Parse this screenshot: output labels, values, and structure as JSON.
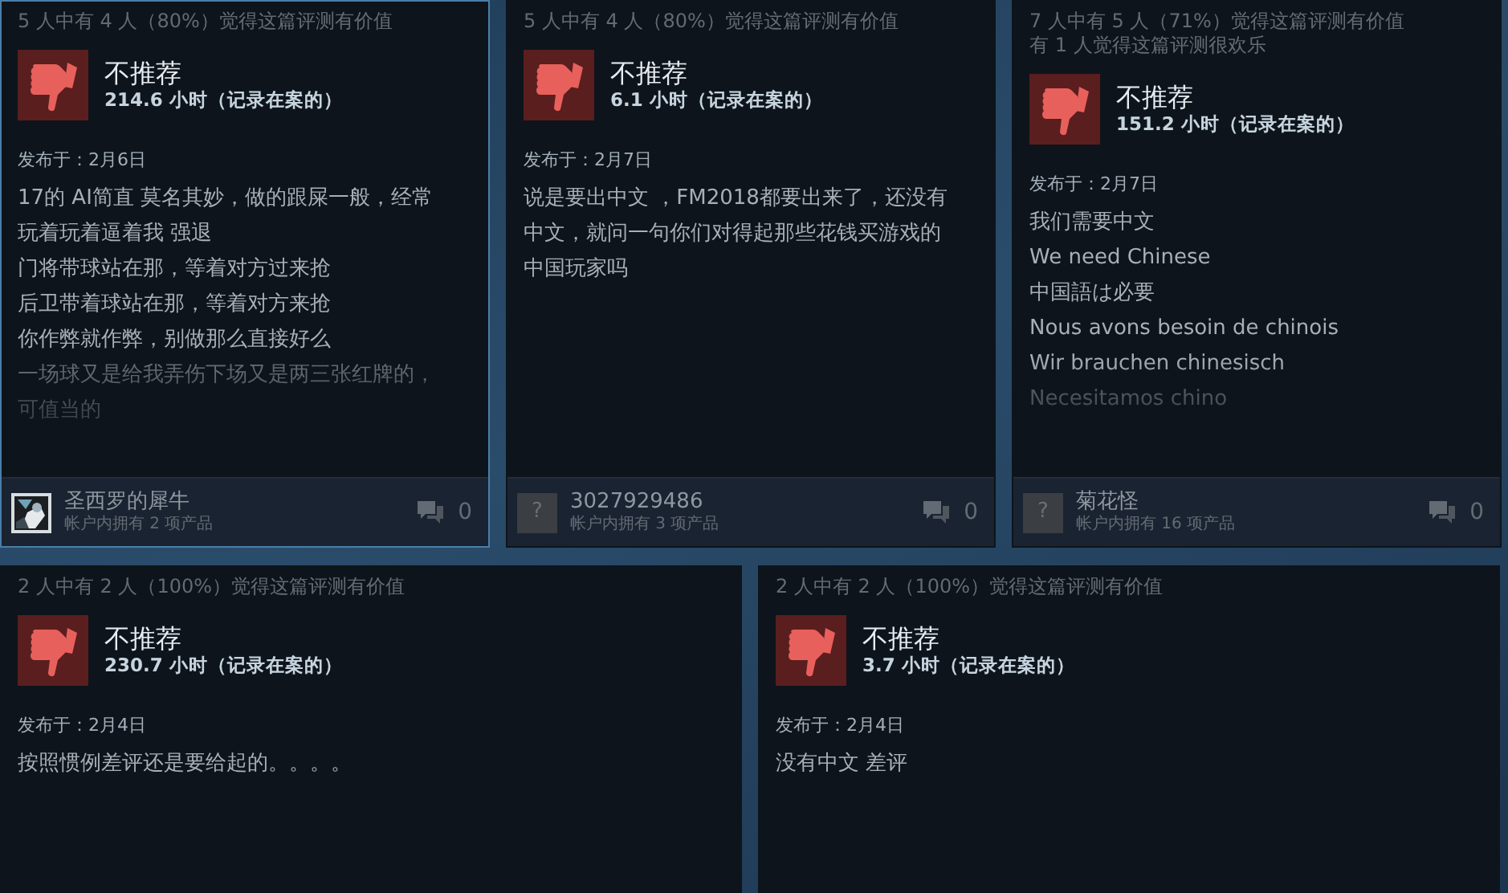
{
  "reviews": [
    {
      "helpful": [
        "5 人中有 4 人（80%）觉得这篇评测有价值"
      ],
      "selected": true,
      "verdict": "不推荐",
      "hours": "214.6 小时（记录在案的）",
      "posted": "发布于：2月6日",
      "paragraphs": [
        "17的 AI简直 莫名其妙，做的跟屎一般，经常玩着玩着逼着我 强退",
        "门将带球站在那，等着对方过来抢",
        "后卫带着球站在那，等着对方来抢",
        "你作弊就作弊，别做那么直接好么",
        "一场球又是给我弄伤下场又是两三张红牌的，可值当的"
      ],
      "truncated": true,
      "author": {
        "name": "圣西罗的犀牛",
        "products": "帐户内拥有 2 项产品"
      },
      "comments": "0"
    },
    {
      "helpful": [
        "5 人中有 4 人（80%）觉得这篇评测有价值"
      ],
      "selected": false,
      "verdict": "不推荐",
      "hours": "6.1 小时（记录在案的）",
      "posted": "发布于：2月7日",
      "paragraphs": [
        "说是要出中文 ，FM2018都要出来了，还没有中文，就问一句你们对得起那些花钱买游戏的中国玩家吗"
      ],
      "truncated": false,
      "author": {
        "avatar": {
          "kind": "placeholder",
          "text": "?"
        },
        "name": "3027929486",
        "products": "帐户内拥有 3 项产品"
      },
      "comments": "0"
    },
    {
      "helpful": [
        "7 人中有 5 人（71%）觉得这篇评测有价值",
        "有 1 人觉得这篇评测很欢乐"
      ],
      "selected": false,
      "verdict": "不推荐",
      "hours": "151.2 小时（记录在案的）",
      "posted": "发布于：2月7日",
      "paragraphs": [
        "我们需要中文",
        "We need Chinese",
        "中国語は必要",
        "Nous avons besoin de chinois",
        "Wir brauchen chinesisch",
        "Necesitamos chino"
      ],
      "truncated": true,
      "author": {
        "avatar": {
          "kind": "placeholder",
          "text": "?"
        },
        "name": "菊花怪",
        "products": "帐户内拥有 16 项产品"
      },
      "comments": "0"
    },
    {
      "helpful": [
        "2 人中有 2 人（100%）觉得这篇评测有价值"
      ],
      "selected": false,
      "verdict": "不推荐",
      "hours": "230.7 小时（记录在案的）",
      "posted": "发布于：2月4日",
      "paragraphs": [
        "按照惯例差评还是要给起的。。。。"
      ],
      "truncated": false
    },
    {
      "helpful": [
        "2 人中有 2 人（100%）觉得这篇评测有价值"
      ],
      "selected": false,
      "verdict": "不推荐",
      "hours": "3.7 小时（记录在案的）",
      "posted": "发布于：2月4日",
      "paragraphs": [
        "没有中文 差评"
      ],
      "truncated": false
    }
  ]
}
